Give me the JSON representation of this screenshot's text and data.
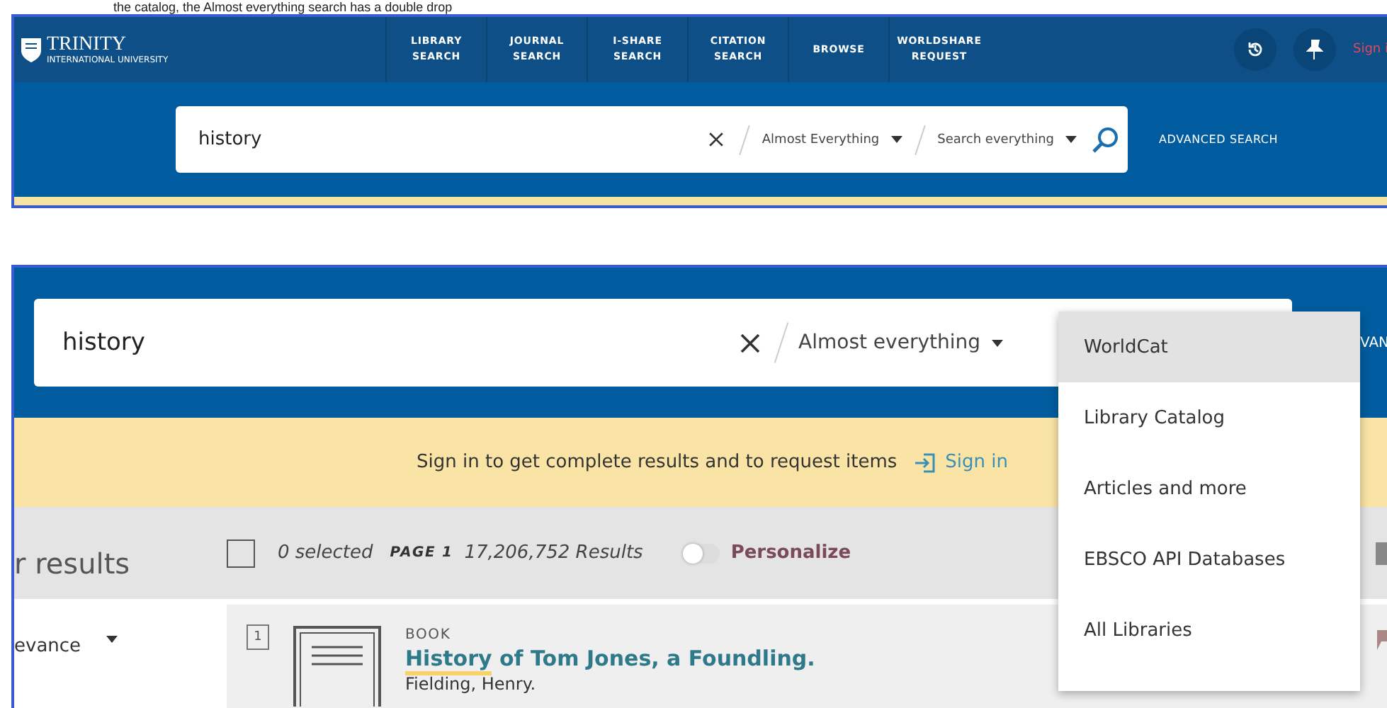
{
  "caption": "the catalog, the Almost everything search has a double drop",
  "top_screenshot": {
    "logo": {
      "name": "TRINITY",
      "subtitle": "INTERNATIONAL UNIVERSITY"
    },
    "nav": [
      {
        "label": "LIBRARY SEARCH"
      },
      {
        "label": "JOURNAL SEARCH"
      },
      {
        "label": "I-SHARE SEARCH"
      },
      {
        "label": "CITATION SEARCH"
      },
      {
        "label": "BROWSE"
      },
      {
        "label": "WORLDSHARE REQUEST"
      }
    ],
    "sign_in": "Sign i",
    "search": {
      "value": "history",
      "scope": "Almost Everything",
      "tab": "Search everything"
    },
    "advanced_search": "ADVANCED SEARCH"
  },
  "bottom_screenshot": {
    "search": {
      "value": "history",
      "scope": "Almost everything"
    },
    "advanced_search": "VAN",
    "banner": {
      "message": "Sign in to get complete results and to request items",
      "link": "Sign in"
    },
    "facets_title": "r results",
    "sort": "evance",
    "toolbar": {
      "select_all_checked": false,
      "selected_count": "0 selected",
      "page": "PAGE 1",
      "results": "17,206,752 Results",
      "personalize": {
        "label": "Personalize",
        "on": false
      }
    },
    "result": {
      "number": "1",
      "type": "BOOK",
      "title_parts": [
        {
          "text": "History",
          "highlighted": true
        },
        {
          "text": " of Tom Jones, a Foundling.",
          "highlighted": false
        }
      ],
      "author": "Fielding, Henry."
    },
    "dropdown": [
      {
        "label": "WorldCat",
        "selected": true
      },
      {
        "label": "Library Catalog",
        "selected": false
      },
      {
        "label": "Articles and more",
        "selected": false
      },
      {
        "label": "EBSCO API Databases",
        "selected": false
      },
      {
        "label": "All Libraries",
        "selected": false
      }
    ]
  }
}
